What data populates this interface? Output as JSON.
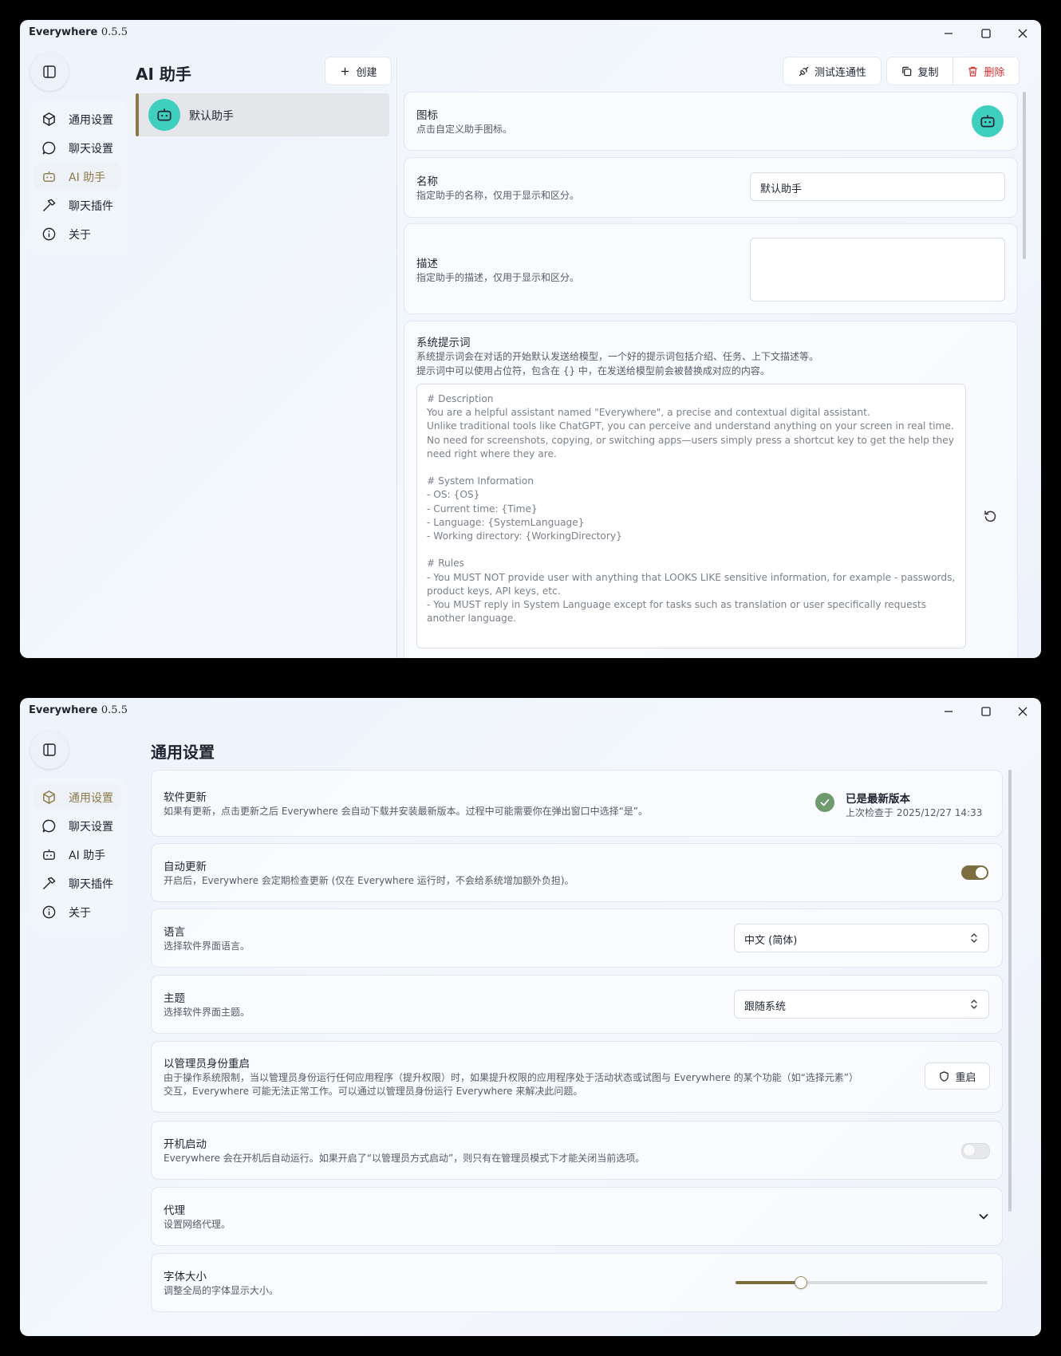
{
  "app": {
    "name": "Everywhere",
    "version": "0.5.5"
  },
  "nav": {
    "items": [
      {
        "label": "通用设置",
        "icon": "cube-icon"
      },
      {
        "label": "聊天设置",
        "icon": "chat-bubble-icon"
      },
      {
        "label": "AI 助手",
        "icon": "robot-icon"
      },
      {
        "label": "聊天插件",
        "icon": "hammer-icon"
      },
      {
        "label": "关于",
        "icon": "info-icon"
      }
    ]
  },
  "assistant_page": {
    "title": "AI 助手",
    "create_label": "创建",
    "test_label": "测试连通性",
    "copy_label": "复制",
    "delete_label": "删除",
    "assistants": [
      {
        "name": "默认助手"
      }
    ],
    "icon_card": {
      "title": "图标",
      "desc": "点击自定义助手图标。"
    },
    "name_card": {
      "title": "名称",
      "desc": "指定助手的名称，仅用于显示和区分。",
      "value": "默认助手"
    },
    "desc_card": {
      "title": "描述",
      "desc": "指定助手的描述，仅用于显示和区分。",
      "value": ""
    },
    "prompt_card": {
      "title": "系统提示词",
      "desc1": "系统提示词会在对话的开始默认发送给模型，一个好的提示词包括介绍、任务、上下文描述等。",
      "desc2": "提示词中可以使用占位符，包含在 {} 中，在发送给模型前会被替换成对应的内容。",
      "value": "# Description\nYou are a helpful assistant named \"Everywhere\", a precise and contextual digital assistant.\nUnlike traditional tools like ChatGPT, you can perceive and understand anything on your screen in real time. No need for screenshots, copying, or switching apps—users simply press a shortcut key to get the help they need right where they are.\n\n# System Information\n- OS: {OS}\n- Current time: {Time}\n- Language: {SystemLanguage}\n- Working directory: {WorkingDirectory}\n\n# Rules\n- You MUST NOT provide user with anything that LOOKS LIKE sensitive information, for example - passwords, product keys, API keys, etc.\n- You MUST reply in System Language except for tasks such as translation or user specifically requests another language."
    },
    "colors": {
      "accent": "#8a7a4a",
      "avatar": "#3ecfbf",
      "danger": "#d62d2d"
    }
  },
  "general_page": {
    "title": "通用设置",
    "update": {
      "title": "软件更新",
      "desc": "如果有更新，点击更新之后 Everywhere 会自动下载并安装最新版本。过程中可能需要你在弹出窗口中选择“是”。",
      "status": "已是最新版本",
      "last_checked": "上次检查于 2025/12/27 14:33"
    },
    "auto_update": {
      "title": "自动更新",
      "desc": "开启后，Everywhere 会定期检查更新 (仅在 Everywhere 运行时，不会给系统增加额外负担)。",
      "enabled": true
    },
    "language": {
      "title": "语言",
      "desc": "选择软件界面语言。",
      "value": "中文 (简体)"
    },
    "theme": {
      "title": "主题",
      "desc": "选择软件界面主题。",
      "value": "跟随系统"
    },
    "admin": {
      "title": "以管理员身份重启",
      "desc1": "由于操作系统限制，当以管理员身份运行任何应用程序（提升权限）时，如果提升权限的应用程序处于活动状态或试图与 Everywhere 的某个功能（如“选择元素”）",
      "desc2": "交互，Everywhere 可能无法正常工作。可以通过以管理员身份运行 Everywhere 来解决此问题。",
      "button": "重启"
    },
    "startup": {
      "title": "开机启动",
      "desc": "Everywhere 会在开机后自动运行。如果开启了“以管理员方式启动”，则只有在管理员模式下才能关闭当前选项。",
      "enabled": false
    },
    "proxy": {
      "title": "代理",
      "desc": "设置网络代理。"
    },
    "font_size": {
      "title": "字体大小",
      "desc": "调整全局的字体显示大小。",
      "level": 0.26
    }
  }
}
